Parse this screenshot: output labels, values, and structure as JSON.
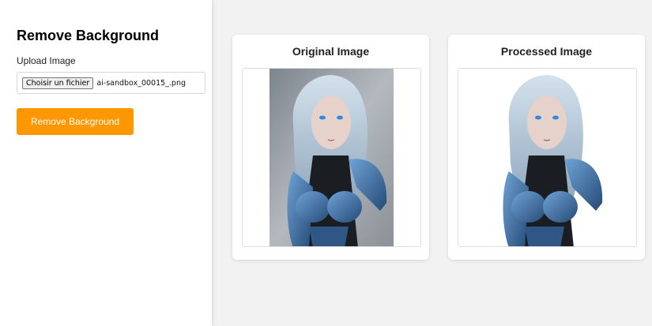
{
  "sidebar": {
    "title": "Remove Background",
    "upload_label": "Upload Image",
    "file_button_label": "Choisir un fichier",
    "file_name": "ai-sandbox_00015_.png",
    "action_button_label": "Remove Background"
  },
  "main": {
    "original_title": "Original Image",
    "processed_title": "Processed Image"
  },
  "colors": {
    "accent": "#ff9800",
    "page_background": "#f2f2f2"
  }
}
